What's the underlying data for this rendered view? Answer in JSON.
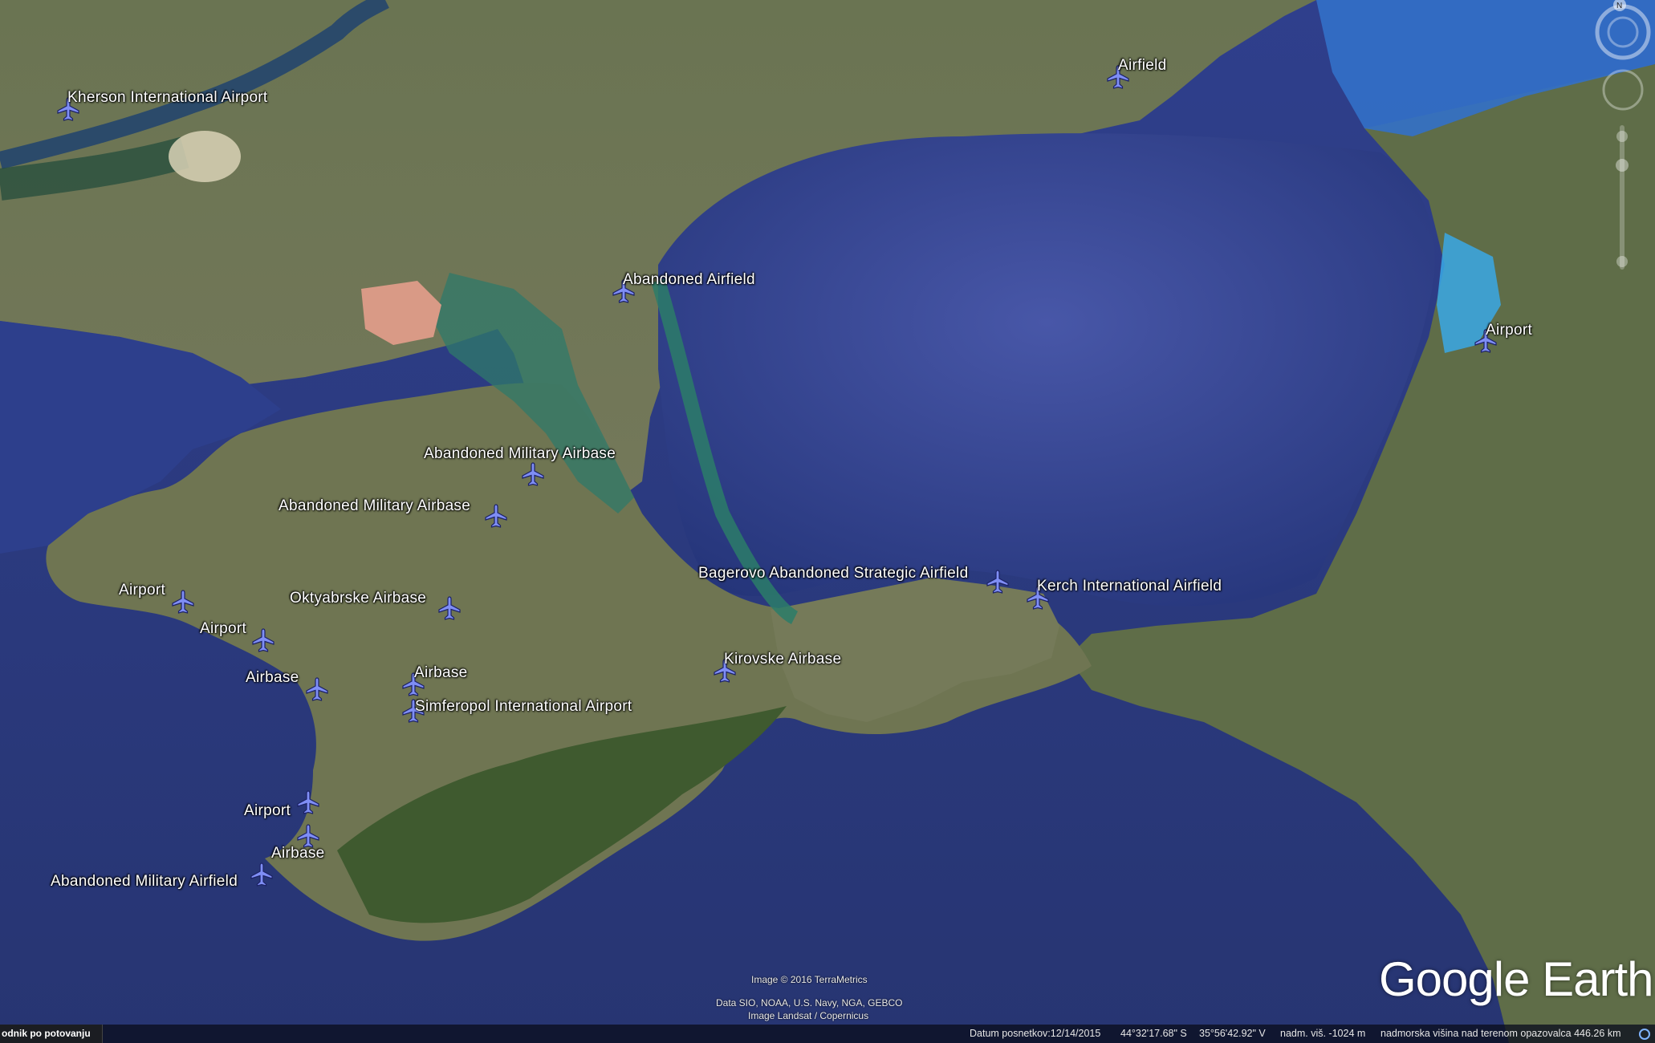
{
  "markers": [
    {
      "id": "kherson",
      "label": "Kherson International Airport"
    },
    {
      "id": "airfield-ne",
      "label": "Airfield"
    },
    {
      "id": "abandoned-airfield",
      "label": "Abandoned Airfield"
    },
    {
      "id": "airport-east",
      "label": "Airport"
    },
    {
      "id": "abandoned-mil-airbase-1",
      "label": "Abandoned Military Airbase"
    },
    {
      "id": "abandoned-mil-airbase-2",
      "label": "Abandoned Military Airbase"
    },
    {
      "id": "airport-west-1",
      "label": "Airport"
    },
    {
      "id": "airport-west-2",
      "label": "Airport"
    },
    {
      "id": "oktyabrske",
      "label": "Oktyabrske Airbase"
    },
    {
      "id": "airbase-west",
      "label": "Airbase"
    },
    {
      "id": "airbase-central",
      "label": "Airbase"
    },
    {
      "id": "simferopol",
      "label": "Simferopol International Airport"
    },
    {
      "id": "bagerovo",
      "label": "Bagerovo Abandoned Strategic Airfield"
    },
    {
      "id": "kerch",
      "label": "Kerch International Airfield"
    },
    {
      "id": "kirovske",
      "label": "Kirovske Airbase"
    },
    {
      "id": "airport-south",
      "label": "Airport"
    },
    {
      "id": "airbase-south",
      "label": "Airbase"
    },
    {
      "id": "abandoned-mil-airfield",
      "label": "Abandoned Military Airfield"
    }
  ],
  "credits": {
    "image": "Image © 2016 TerraMetrics",
    "data": "Data SIO, NOAA, U.S. Navy, NGA, GEBCO",
    "landsat": "Image Landsat / Copernicus"
  },
  "logo": "Google Earth",
  "compass_letter": "N",
  "status": {
    "sidebar": "odnik po potovanju",
    "date": "Datum posnetkov:12/14/2015",
    "lat": "44°32'17.68\" S",
    "lon": "35°56'42.92\" V",
    "elev": "nadm. viš. -1024 m",
    "eye": "nadmorska višina nad terenom opazovalca 446.26 km"
  },
  "colors": {
    "sea": "#35479a",
    "land": "#6c7550",
    "marker": "#7f8ef5"
  }
}
